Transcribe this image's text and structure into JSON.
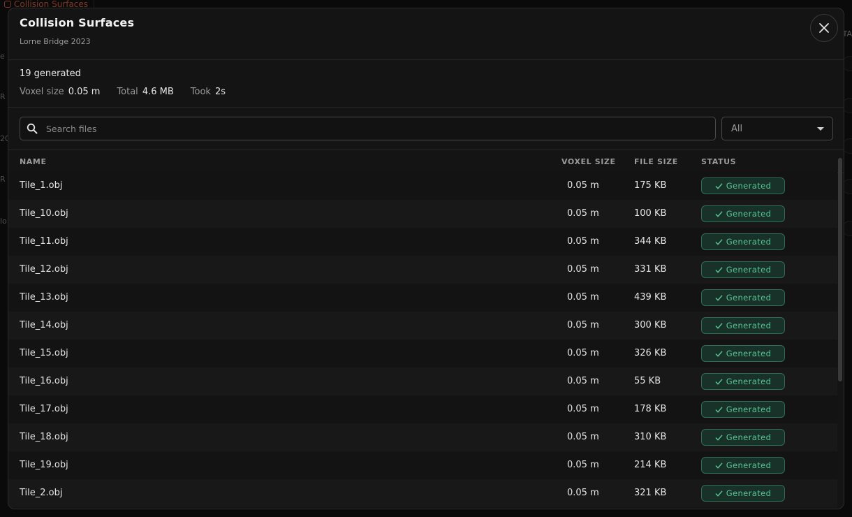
{
  "background": {
    "tab_label": "Collision Surfaces",
    "left_fragments": [
      "e",
      "R",
      "20",
      "R",
      "lo"
    ],
    "right_fragment": "TA"
  },
  "modal": {
    "title": "Collision Surfaces",
    "subtitle": "Lorne Bridge 2023",
    "close_icon": "close-icon"
  },
  "summary": {
    "count": "19 generated",
    "voxel_label": "Voxel size",
    "voxel_value": "0.05 m",
    "total_label": "Total",
    "total_value": "4.6 MB",
    "took_label": "Took",
    "took_value": "2s"
  },
  "toolbar": {
    "search_placeholder": "Search files",
    "search_value": "",
    "filter_value": "All"
  },
  "table": {
    "headers": {
      "name": "NAME",
      "voxel": "VOXEL SIZE",
      "file": "FILE SIZE",
      "status": "STATUS"
    },
    "rows": [
      {
        "name": "Tile_1.obj",
        "voxel": "0.05 m",
        "file": "175 KB",
        "status": "Generated"
      },
      {
        "name": "Tile_10.obj",
        "voxel": "0.05 m",
        "file": "100 KB",
        "status": "Generated"
      },
      {
        "name": "Tile_11.obj",
        "voxel": "0.05 m",
        "file": "344 KB",
        "status": "Generated"
      },
      {
        "name": "Tile_12.obj",
        "voxel": "0.05 m",
        "file": "331 KB",
        "status": "Generated"
      },
      {
        "name": "Tile_13.obj",
        "voxel": "0.05 m",
        "file": "439 KB",
        "status": "Generated"
      },
      {
        "name": "Tile_14.obj",
        "voxel": "0.05 m",
        "file": "300 KB",
        "status": "Generated"
      },
      {
        "name": "Tile_15.obj",
        "voxel": "0.05 m",
        "file": "326 KB",
        "status": "Generated"
      },
      {
        "name": "Tile_16.obj",
        "voxel": "0.05 m",
        "file": "55 KB",
        "status": "Generated"
      },
      {
        "name": "Tile_17.obj",
        "voxel": "0.05 m",
        "file": "178 KB",
        "status": "Generated"
      },
      {
        "name": "Tile_18.obj",
        "voxel": "0.05 m",
        "file": "310 KB",
        "status": "Generated"
      },
      {
        "name": "Tile_19.obj",
        "voxel": "0.05 m",
        "file": "214 KB",
        "status": "Generated"
      },
      {
        "name": "Tile_2.obj",
        "voxel": "0.05 m",
        "file": "321 KB",
        "status": "Generated"
      }
    ]
  },
  "colors": {
    "accent_background_tab": "#c0563b",
    "status_green": "#5cc596",
    "status_green_bg": "#183229"
  }
}
